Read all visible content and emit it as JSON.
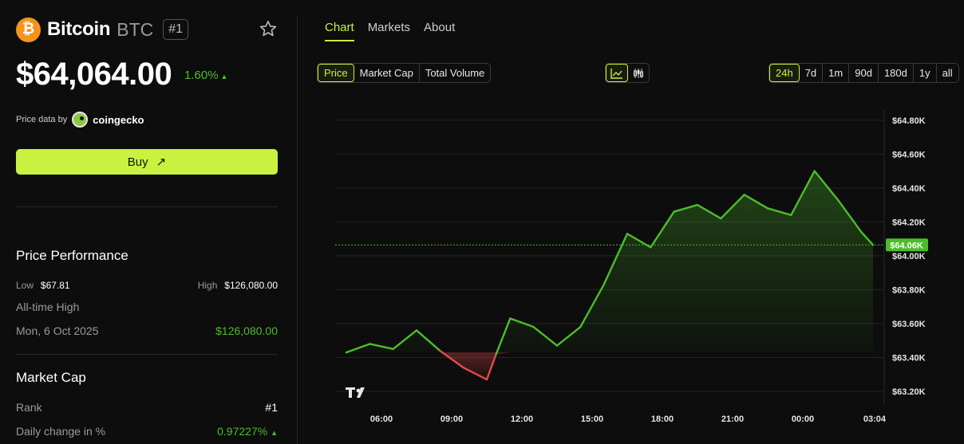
{
  "coin": {
    "logo_glyph": "₿",
    "name": "Bitcoin",
    "symbol": "BTC",
    "rank_badge": "#1",
    "price": "$64,064.00",
    "change": "1.60%",
    "change_arrow": "▲",
    "change_color": "#4dbd2b",
    "brand_color": "#f7931a"
  },
  "source": {
    "label": "Price data by",
    "name": "coingecko"
  },
  "buy": {
    "label": "Buy",
    "arrow": "↗",
    "color": "#c8f23f"
  },
  "performance": {
    "title": "Price Performance",
    "low_label": "Low",
    "low_value": "$67.81",
    "high_label": "High",
    "high_value": "$126,080.00",
    "ath_label": "All-time High",
    "ath_date": "Mon, 6 Oct 2025",
    "ath_value": "$126,080.00"
  },
  "market_cap": {
    "title": "Market Cap",
    "rank_label": "Rank",
    "rank_value": "#1",
    "daily_label": "Daily change in %",
    "daily_value": "0.97227%",
    "daily_arrow": "▲"
  },
  "tabs": [
    "Chart",
    "Markets",
    "About"
  ],
  "metric_buttons": [
    "Price",
    "Market Cap",
    "Total Volume"
  ],
  "view_icons": [
    "line-chart-icon",
    "candlestick-icon"
  ],
  "range_buttons": [
    "24h",
    "7d",
    "1m",
    "90d",
    "180d",
    "1y",
    "all"
  ],
  "chart_data": {
    "type": "area",
    "x": [
      "04:30",
      "05:30",
      "06:30",
      "07:30",
      "08:30",
      "09:30",
      "10:30",
      "10:54",
      "11:30",
      "12:30",
      "13:30",
      "14:30",
      "15:30",
      "16:30",
      "17:30",
      "18:30",
      "19:30",
      "20:30",
      "21:30",
      "22:30",
      "23:30",
      "00:30",
      "01:30",
      "02:30",
      "03:00"
    ],
    "values": [
      63430,
      63480,
      63450,
      63560,
      63440,
      63340,
      63270,
      63420,
      63630,
      63580,
      63470,
      63580,
      63830,
      64130,
      64050,
      64260,
      64300,
      64220,
      64360,
      64280,
      64240,
      64500,
      64330,
      64140,
      64064
    ],
    "current_label": "$64.06K",
    "current_value": 64064,
    "ylim": [
      63120,
      64860
    ],
    "y_ticks": [
      "$63.20K",
      "$63.40K",
      "$63.60K",
      "$63.80K",
      "$64.00K",
      "$64.20K",
      "$64.40K",
      "$64.60K",
      "$64.80K"
    ],
    "y_tick_values": [
      63200,
      63400,
      63600,
      63800,
      64000,
      64200,
      64400,
      64600,
      64800
    ],
    "x_ticks": [
      "06:00",
      "09:00",
      "12:00",
      "15:00",
      "18:00",
      "21:00",
      "00:00",
      "03:04"
    ],
    "up_color": "#4dbd2b",
    "down_color": "#e5484d",
    "grid": true,
    "watermark": "TV"
  }
}
